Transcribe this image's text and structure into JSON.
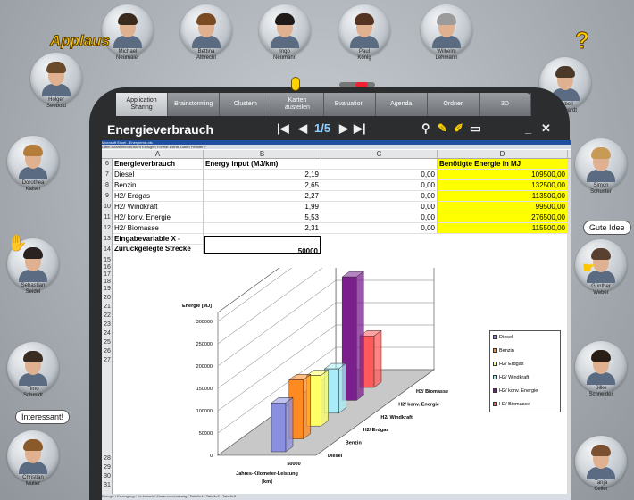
{
  "participants": {
    "top": [
      {
        "name": "Michael\nNeumaier"
      },
      {
        "name": "Bettina\nAlbrecht"
      },
      {
        "name": "Ingo\nNeumann"
      },
      {
        "name": "Paul\nKönig"
      },
      {
        "name": "Wilhelm\nLehmann"
      }
    ],
    "left": [
      {
        "name": "Holger\nSeebold"
      },
      {
        "name": "Dorothea\nKaiser"
      },
      {
        "name": "Sebastian\nSeidel"
      },
      {
        "name": "Timo\nSchmidt"
      },
      {
        "name": "Christian\nMüller"
      }
    ],
    "right": [
      {
        "name": "Isabell\nReinhardt"
      },
      {
        "name": "Simon\nSchuster"
      },
      {
        "name": "Günther\nWeber"
      },
      {
        "name": "Silke\nSchneider"
      },
      {
        "name": "Tanja\nKeller"
      }
    ]
  },
  "applaus": "Applaus",
  "question": "?",
  "balloons": {
    "gute_idee": "Gute Idee",
    "interessant": "Interessant!"
  },
  "tabs": [
    "Application\nSharing",
    "Brainstorming",
    "Clustern",
    "Karten\nausteilen",
    "Evaluation",
    "Agenda",
    "Ordner",
    "3D"
  ],
  "window": {
    "title": "Energieverbrauch",
    "page": "1/5",
    "minimize": "_",
    "close": "✕"
  },
  "excel": {
    "title_bar": "Microsoft Excel - Energiemix.xls",
    "menu": "Datei Bearbeiten Ansicht Einfügen Format Extras Daten Fenster ?",
    "columns": [
      "A",
      "B",
      "C",
      "D"
    ],
    "row_numbers": [
      "6",
      "7",
      "8",
      "9",
      "10",
      "11",
      "12",
      "13",
      "14",
      "15",
      "16",
      "17",
      "18",
      "19",
      "20",
      "21",
      "22",
      "23",
      "24",
      "25",
      "26",
      "27",
      "28",
      "29",
      "30",
      "31"
    ],
    "header_a": "Energieverbrauch",
    "header_b": "Energy input (MJ/km)",
    "header_d": "Benötigte Energie in MJ",
    "rows": [
      {
        "a": "Diesel",
        "b": "2,19",
        "c": "0,00",
        "d": "109500,00"
      },
      {
        "a": "Benzin",
        "b": "2,65",
        "c": "0,00",
        "d": "132500,00"
      },
      {
        "a": "H2/ Erdgas",
        "b": "2,27",
        "c": "0,00",
        "d": "113500,00"
      },
      {
        "a": "H2/ Windkraft",
        "b": "1,99",
        "c": "0,00",
        "d": "99500,00"
      },
      {
        "a": "H2/ konv. Energie",
        "b": "5,53",
        "c": "0,00",
        "d": "276500,00"
      },
      {
        "a": "H2/ Biomasse",
        "b": "2,31",
        "c": "0,00",
        "d": "115500,00"
      }
    ],
    "input_label_1": "Eingabevariable X -",
    "input_label_2": "Zurückgelegte Strecke",
    "input_value": "50000",
    "sheet_tabs": "Energie / Erzeugung / Verbrauch / Zusammenfassung / Tabelle1 / Tabelle2 / Tabelle3"
  },
  "chart_data": {
    "type": "bar",
    "title": "",
    "ylabel": "Energie [MJ]",
    "xlabel": "Jahres-Kilometer-Leistung\n[km]",
    "categories": [
      "50000"
    ],
    "ylim": [
      0,
      300000
    ],
    "yticks": [
      "0",
      "50000",
      "100000",
      "150000",
      "200000",
      "250000",
      "300000"
    ],
    "series": [
      {
        "name": "Diesel",
        "values": [
          109500
        ],
        "color": "#8b8fe0"
      },
      {
        "name": "Benzin",
        "values": [
          132500
        ],
        "color": "#ff8a1f"
      },
      {
        "name": "H2/ Erdgas",
        "values": [
          113500
        ],
        "color": "#ffff66"
      },
      {
        "name": "H2/ Windkraft",
        "values": [
          99500
        ],
        "color": "#a9ecf7"
      },
      {
        "name": "H2/ konv. Energie",
        "values": [
          276500
        ],
        "color": "#7a1f8c"
      },
      {
        "name": "H2/ Biomasse",
        "values": [
          115500
        ],
        "color": "#ff5a5a"
      }
    ],
    "depth_labels": [
      "Diesel",
      "Benzin",
      "H2/ Erdgas",
      "H2/ Windkraft",
      "H2/ konv. Energie",
      "H2/ Biomasse"
    ]
  },
  "colors": {
    "highlight": "#ffff00",
    "frame": "#2b2d2f"
  }
}
